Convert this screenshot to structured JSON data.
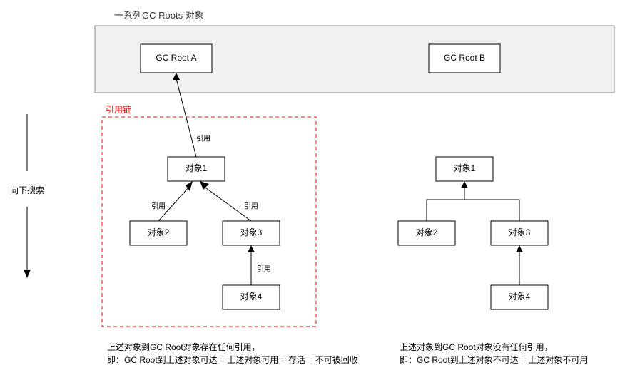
{
  "title": "一系列GC Roots 对象",
  "panel": {
    "rootA": "GC Root A",
    "rootB": "GC Root B"
  },
  "refChainLabel": "引用链",
  "searchDown": "向下搜索",
  "edgeLabel": "引用",
  "left": {
    "obj1": "对象1",
    "obj2": "对象2",
    "obj3": "对象3",
    "obj4": "对象4",
    "caption1": "上述对象到GC Root对象存在任何引用，",
    "caption2": "即：GC Root到上述对象可达 = 上述对象可用 = 存活 = 不可被回收"
  },
  "right": {
    "obj1": "对象1",
    "obj2": "对象2",
    "obj3": "对象3",
    "obj4": "对象4",
    "caption1": "上述对象到GC Root对象没有任何引用，",
    "caption2": "即：GC Root到上述对象不可达 = 上述对象不可用"
  }
}
